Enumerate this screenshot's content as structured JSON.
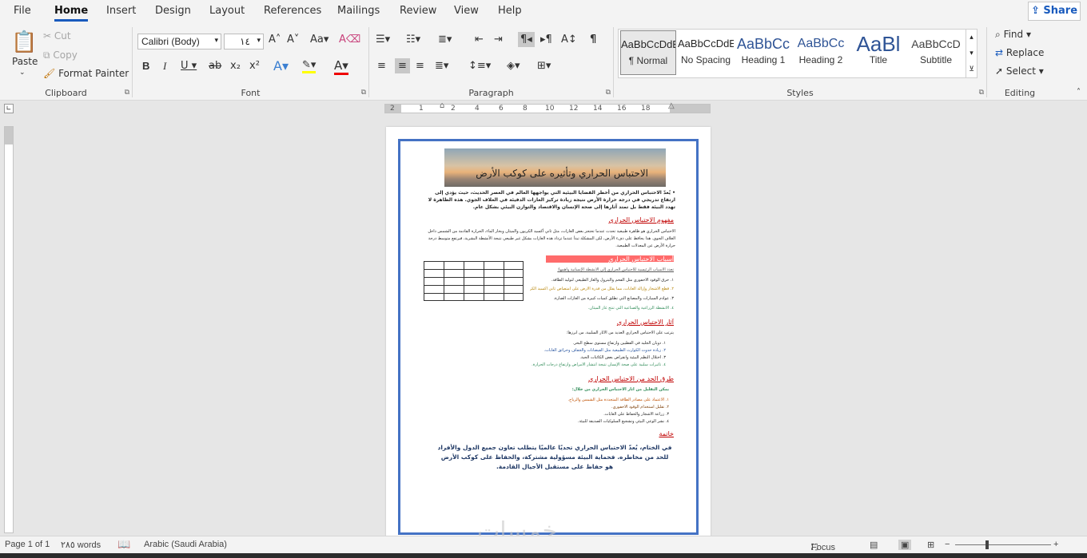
{
  "tabs": [
    "File",
    "Home",
    "Insert",
    "Design",
    "Layout",
    "References",
    "Mailings",
    "Review",
    "View",
    "Help"
  ],
  "share_label": "Share",
  "clipboard": {
    "paste": "Paste",
    "cut": "Cut",
    "copy": "Copy",
    "format_painter": "Format Painter",
    "label": "Clipboard"
  },
  "font": {
    "name": "Calibri (Body)",
    "size": "١٤",
    "label": "Font"
  },
  "paragraph": {
    "label": "Paragraph"
  },
  "styles": {
    "label": "Styles",
    "items": [
      {
        "preview": "AaBbCcDdE",
        "name": "¶ Normal"
      },
      {
        "preview": "AaBbCcDdE",
        "name": "No Spacing"
      },
      {
        "preview": "AaBbCc",
        "name": "Heading 1"
      },
      {
        "preview": "AaBbCc",
        "name": "Heading 2"
      },
      {
        "preview": "AaBl",
        "name": "Title"
      },
      {
        "preview": "AaBbCcD",
        "name": "Subtitle"
      }
    ]
  },
  "editing": {
    "find": "Find",
    "replace": "Replace",
    "select": "Select",
    "label": "Editing"
  },
  "ruler": {
    "marks": [
      "2",
      "1",
      "2",
      "4",
      "6",
      "8",
      "10",
      "12",
      "14",
      "16",
      "18"
    ]
  },
  "document": {
    "title": "الاحتباس الحراري وتأثيره على كوكب الأرض",
    "intro": "يُعدّ الاحتباس الحراري من أخطر القضايا البيئية التي يواجهها العالم في العصر الحديث، حيث يؤدي إلى ارتفاع تدريجي في درجة حرارة الأرض نتيجة زيادة تركيز الغازات الدفيئة في الغلاف الجوي. هذه الظاهرة لا تهدد البيئة فقط بل تمتد آثارها إلى صحة الإنسان والاقتصاد والتوازن البيئي بشكل عام.",
    "h1": "مفهوم الاحتباس الحراري",
    "p1": "الاحتباس الحراري هو ظاهرة طبيعية تحدث عندما تحتجز بعض الغازات، مثل ثاني أكسيد الكربون والميثان وبخار الماء، الحرارة القادمة من الشمس داخل الغلاف الجوي. هذا يحافظ على دفء الأرض، لكن المشكلة تبدأ عندما تزداد هذه الغازات بشكل غير طبيعي نتيجة الأنشطة البشرية، فيرتفع متوسط درجة حرارة الأرض عن المعدلات الطبيعية.",
    "h2": "أسباب الاحتباس الحراري",
    "causes_intro": "تعدد الأسباب الرئيسية للاحتباس الحراري إلى الأنشطة الإنسانية وأهمها:",
    "causes": [
      "١. حرق الوقود الأحفوري مثل الفحم والبترول والغاز الطبيعي لتوليد الطاقة.",
      "٢. قطع الأشجار وإزالة الغابات، مما يقلل من قدرة الأرض على امتصاص ثاني أكسيد الكربون.",
      "٣. عوادم السيارات والمصانع التي تطلق كميات كبيرة من الغازات الضارة.",
      "٤. الأنشطة الزراعية والصناعية التي تنتج غاز الميثان."
    ],
    "h3": "آثار الاحتباس الحراري",
    "effects_intro": "يترتب على الاحتباس الحراري العديد من الآثار السلبية، من أبرزها:",
    "effects": [
      "١. ذوبان الجليد في القطبين وارتفاع مستوى سطح البحر.",
      "٢. زيادة حدوث الكوارث الطبيعية مثل الفيضانات والجفاف وحرائق الغابات.",
      "٣. اختلال النظم البيئية وانقراض بعض الكائنات الحية.",
      "٤. تأثيرات سلبية على صحة الإنسان نتيجة انتشار الأمراض وارتفاع درجات الحرارة."
    ],
    "h4": "طرق الحد من الاحتباس الحراري",
    "solutions_intro": "يمكن التقليل من آثار الاحتباس الحراري من خلال:",
    "solutions": [
      "١. الاعتماد على مصادر الطاقة المتجددة مثل الشمس والرياح.",
      "٢. تقليل استخدام الوقود الأحفوري.",
      "٣. زراعة الأشجار والحفاظ على الغابات.",
      "٤. نشر الوعي البيئي وتشجيع السلوكيات الصديقة للبيئة."
    ],
    "h5": "خاتمة",
    "conclusion": "في الختام، يُعدّ الاحتباس الحراري تحديًا عالميًا يتطلب تعاون جميع الدول والأفراد للحد من مخاطره. فحماية البيئة مسؤولية مشتركة، والحفاظ على كوكب الأرض هو حفاظ على مستقبل الأجيال القادمة."
  },
  "status": {
    "page": "Page 1 of 1",
    "words": "٢٨٥ words",
    "language": "Arabic (Saudi Arabia)",
    "focus": "Focus"
  },
  "watermark": "خمسات",
  "colors": {
    "accent": "#185abd",
    "page_border": "#4472c4",
    "heading": "#c00000",
    "conclusion": "#1f3864"
  }
}
